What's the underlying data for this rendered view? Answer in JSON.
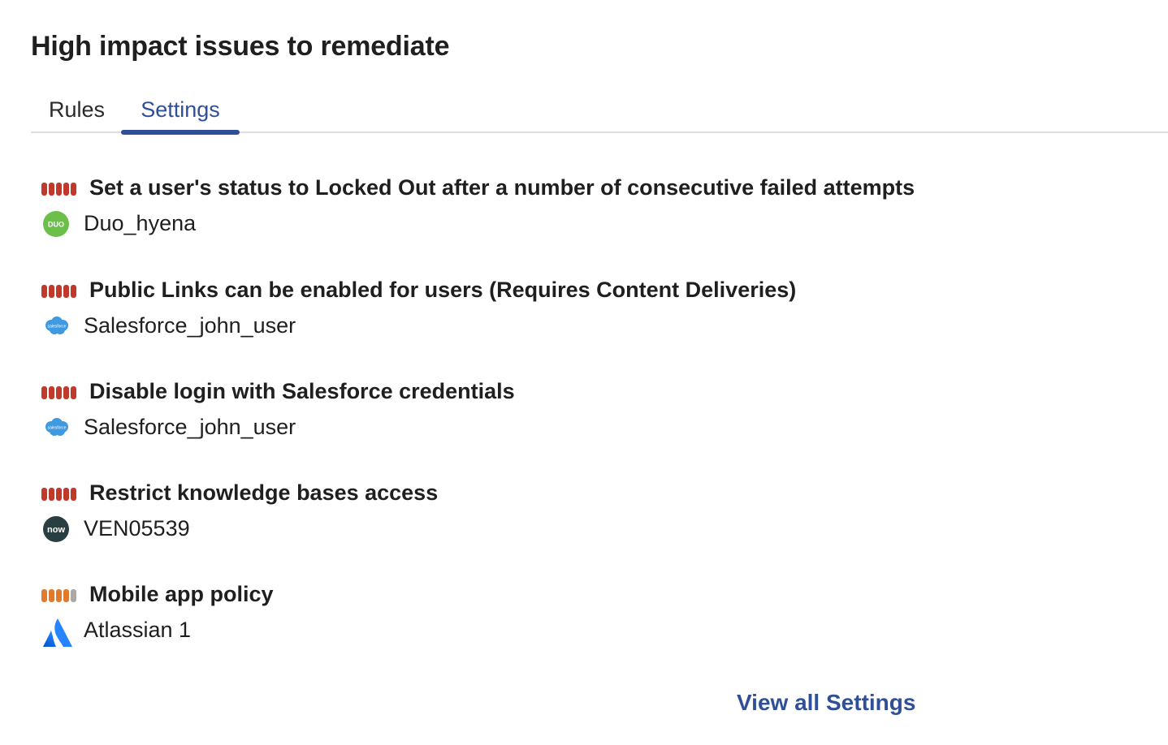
{
  "title": "High impact issues to remediate",
  "tabs": [
    {
      "label": "Rules",
      "active": false
    },
    {
      "label": "Settings",
      "active": true
    }
  ],
  "colors": {
    "accent": "#2f4f96",
    "severity_high": "#c0392b",
    "severity_medium": "#e07b2e",
    "severity_empty": "#a9a9a9"
  },
  "issues": [
    {
      "title": "Set a user's status to Locked Out after a number of consecutive failed attempts",
      "app": "Duo_hyena",
      "app_icon": "duo-icon",
      "severity_level": 5
    },
    {
      "title": "Public Links can be enabled for users (Requires Content Deliveries)",
      "app": "Salesforce_john_user",
      "app_icon": "salesforce-icon",
      "severity_level": 5
    },
    {
      "title": "Disable login with Salesforce credentials",
      "app": "Salesforce_john_user",
      "app_icon": "salesforce-icon",
      "severity_level": 5
    },
    {
      "title": "Restrict knowledge bases access",
      "app": "VEN05539",
      "app_icon": "servicenow-icon",
      "severity_level": 5
    },
    {
      "title": "Mobile app policy",
      "app": "Atlassian 1",
      "app_icon": "atlassian-icon",
      "severity_level": 4
    }
  ],
  "view_all_label": "View all Settings",
  "icon_text": {
    "duo": "DUO",
    "salesforce": "salesforce",
    "servicenow": "now"
  }
}
